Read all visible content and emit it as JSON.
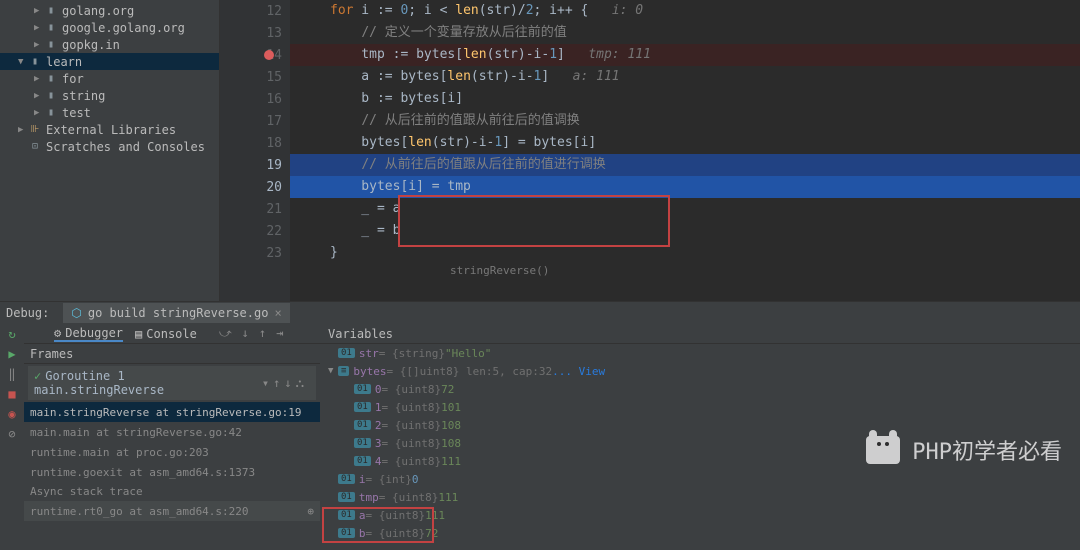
{
  "sidebar": {
    "items": [
      {
        "label": "golang.org",
        "expand": "▶",
        "indent": 2
      },
      {
        "label": "google.golang.org",
        "expand": "▶",
        "indent": 2
      },
      {
        "label": "gopkg.in",
        "expand": "▶",
        "indent": 2
      },
      {
        "label": "learn",
        "expand": "▼",
        "indent": 1,
        "selected": true
      },
      {
        "label": "for",
        "expand": "▶",
        "indent": 2
      },
      {
        "label": "string",
        "expand": "▶",
        "indent": 2
      },
      {
        "label": "test",
        "expand": "▶",
        "indent": 2
      }
    ],
    "ext_lib": "External Libraries",
    "scratches": "Scratches and Consoles"
  },
  "code": {
    "lines": [
      {
        "n": "12",
        "html": "<span class='kw'>for</span> i <span class='op'>:=</span> <span class='num'>0</span>; i <span class='op'>&lt;</span> <span class='fn'>len</span>(str)/<span class='num'>2</span>; i<span class='op'>++</span> {   <span class='inline-hint'>i: 0</span>"
      },
      {
        "n": "13",
        "html": "    <span class='cmt'>// 定义一个变量存放从后往前的值</span>"
      },
      {
        "n": "14",
        "html": "    tmp <span class='op'>:=</span> bytes[<span class='fn'>len</span>(str)-i-<span class='num'>1</span>]   <span class='inline-hint'>tmp: 111</span>",
        "bp": true
      },
      {
        "n": "15",
        "html": "    a <span class='op'>:=</span> bytes[<span class='fn'>len</span>(str)-i-<span class='num'>1</span>]   <span class='inline-hint'>a: 111</span>"
      },
      {
        "n": "16",
        "html": "    b <span class='op'>:=</span> bytes[i]"
      },
      {
        "n": "17",
        "html": "    <span class='cmt'>// 从后往前的值跟从前往后的值调换</span>"
      },
      {
        "n": "18",
        "html": "    bytes[<span class='fn'>len</span>(str)-i-<span class='num'>1</span>] <span class='op'>=</span> bytes[i]"
      },
      {
        "n": "19",
        "html": "    <span class='cmt'>// 从前往后的值跟从后往前的值进行调换</span>",
        "l19": true
      },
      {
        "n": "20",
        "html": "    bytes[i] <span class='op'>=</span> tmp",
        "exec": true
      },
      {
        "n": "21",
        "html": "    _ <span class='op'>=</span> a"
      },
      {
        "n": "22",
        "html": "    _ <span class='op'>=</span> b"
      },
      {
        "n": "23",
        "html": "}"
      }
    ],
    "fn_label": "stringReverse()"
  },
  "debug": {
    "label": "Debug:",
    "tab": "go build stringReverse.go",
    "debugger": "Debugger",
    "console": "Console",
    "frames_label": "Frames",
    "vars_label": "Variables",
    "goroutine": "Goroutine 1 main.stringReverse",
    "frames": [
      {
        "t": "main.stringReverse at stringReverse.go:19",
        "sel": true
      },
      {
        "t": "main.main at stringReverse.go:42"
      },
      {
        "t": "runtime.main at proc.go:203"
      },
      {
        "t": "runtime.goexit at asm_amd64.s:1373"
      }
    ],
    "async": "Async stack trace",
    "async_frame": "runtime.rt0_go at asm_amd64.s:220",
    "vars": [
      {
        "arrow": "",
        "badge": "01",
        "name": "str",
        "type": " = {string} ",
        "val": "\"Hello\"",
        "ind": 0
      },
      {
        "arrow": "▼",
        "badge": "≡",
        "name": "bytes",
        "type": " = {[]uint8} len:5, cap:32 ",
        "val": "",
        "view": "... View",
        "ind": 0
      },
      {
        "arrow": "",
        "badge": "01",
        "name": "0",
        "type": " = {uint8} ",
        "val": "72",
        "ind": 1
      },
      {
        "arrow": "",
        "badge": "01",
        "name": "1",
        "type": " = {uint8} ",
        "val": "101",
        "ind": 1
      },
      {
        "arrow": "",
        "badge": "01",
        "name": "2",
        "type": " = {uint8} ",
        "val": "108",
        "ind": 1
      },
      {
        "arrow": "",
        "badge": "01",
        "name": "3",
        "type": " = {uint8} ",
        "val": "108",
        "ind": 1
      },
      {
        "arrow": "",
        "badge": "01",
        "name": "4",
        "type": " = {uint8} ",
        "val": "111",
        "ind": 1
      },
      {
        "arrow": "",
        "badge": "01",
        "name": "i",
        "type": " = {int} ",
        "val": "0",
        "ind": 0,
        "int": true
      },
      {
        "arrow": "",
        "badge": "01",
        "name": "tmp",
        "type": " = {uint8} ",
        "val": "111",
        "ind": 0
      },
      {
        "arrow": "",
        "badge": "01",
        "name": "a",
        "type": " = {uint8} ",
        "val": "111",
        "ind": 0,
        "box": true
      },
      {
        "arrow": "",
        "badge": "01",
        "name": "b",
        "type": " = {uint8} ",
        "val": "72",
        "ind": 0,
        "box": true
      }
    ]
  },
  "watermark": "PHP初学者必看"
}
